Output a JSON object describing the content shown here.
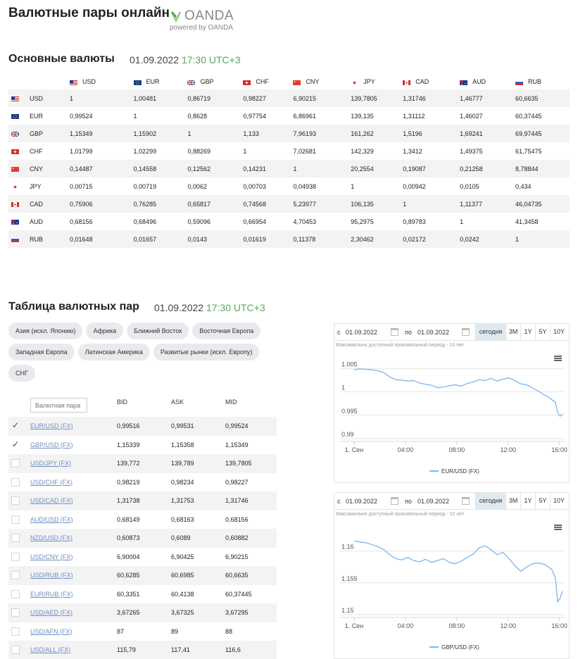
{
  "header": {
    "title": "Валютные пары онлайн",
    "brand": "OANDA",
    "brand_sub": "powered by OANDA"
  },
  "matrix_section": {
    "title": "Основные валюты",
    "date": "01.09.2022",
    "time": "17:30 UTC+3"
  },
  "currencies": [
    "USD",
    "EUR",
    "GBP",
    "CHF",
    "CNY",
    "JPY",
    "CAD",
    "AUD",
    "RUB"
  ],
  "matrix_rows": [
    [
      "1",
      "1,00481",
      "0,86719",
      "0,98227",
      "6,90215",
      "139,7805",
      "1,31746",
      "1,46777",
      "60,6635"
    ],
    [
      "0,99524",
      "1",
      "0,8628",
      "0,97754",
      "6,86961",
      "139,135",
      "1,31112",
      "1,46027",
      "60,37445"
    ],
    [
      "1,15349",
      "1,15902",
      "1",
      "1,133",
      "7,96193",
      "161,262",
      "1,5196",
      "1,69241",
      "69,97445"
    ],
    [
      "1,01799",
      "1,02299",
      "0,88269",
      "1",
      "7,02681",
      "142,329",
      "1,3412",
      "1,49375",
      "61,75475"
    ],
    [
      "0,14487",
      "0,14558",
      "0,12562",
      "0,14231",
      "1",
      "20,2554",
      "0,19087",
      "0,21258",
      "8,78844"
    ],
    [
      "0,00715",
      "0,00719",
      "0,0062",
      "0,00703",
      "0,04938",
      "1",
      "0,00942",
      "0,0105",
      "0,434"
    ],
    [
      "0,75906",
      "0,76285",
      "0,65817",
      "0,74568",
      "5,23977",
      "106,135",
      "1",
      "1,11377",
      "46,04735"
    ],
    [
      "0,68156",
      "0,68496",
      "0,59096",
      "0,66954",
      "4,70453",
      "95,2975",
      "0,89783",
      "1",
      "41,3458"
    ],
    [
      "0,01648",
      "0,01657",
      "0,0143",
      "0,01619",
      "0,11378",
      "2,30462",
      "0,02172",
      "0,0242",
      "1"
    ]
  ],
  "pairs_section": {
    "title": "Таблица валютных пар",
    "date": "01.09.2022",
    "time": "17:30 UTC+3"
  },
  "regions": [
    "Азия (искл. Японию)",
    "Африка",
    "Ближний Восток",
    "Восточная Европа",
    "Западная Европа",
    "Латинская Америка",
    "Развитые рынки (искл. Европу)",
    "СНГ"
  ],
  "pairs_table": {
    "filter_placeholder": "Валютная пара",
    "col_bid": "BID",
    "col_ask": "ASK",
    "col_mid": "MID",
    "rows": [
      {
        "pair": "EUR/USD (FX)",
        "bid": "0,99516",
        "ask": "0,99531",
        "mid": "0,99524",
        "checked": true
      },
      {
        "pair": "GBP/USD (FX)",
        "bid": "1,15339",
        "ask": "1,15358",
        "mid": "1,15349",
        "checked": true
      },
      {
        "pair": "USD/JPY (FX)",
        "bid": "139,772",
        "ask": "139,789",
        "mid": "139,7805",
        "checked": false
      },
      {
        "pair": "USD/CHF (FX)",
        "bid": "0,98219",
        "ask": "0,98234",
        "mid": "0,98227",
        "checked": false
      },
      {
        "pair": "USD/CAD (FX)",
        "bid": "1,31738",
        "ask": "1,31753",
        "mid": "1,31746",
        "checked": false
      },
      {
        "pair": "AUD/USD (FX)",
        "bid": "0,68149",
        "ask": "0,68163",
        "mid": "0,68156",
        "checked": false
      },
      {
        "pair": "NZD/USD (FX)",
        "bid": "0,60873",
        "ask": "0,6089",
        "mid": "0,60882",
        "checked": false
      },
      {
        "pair": "USD/CNY (FX)",
        "bid": "6,90004",
        "ask": "6,90425",
        "mid": "6,90215",
        "checked": false
      },
      {
        "pair": "USD/RUB (FX)",
        "bid": "60,6285",
        "ask": "60,6985",
        "mid": "60,6635",
        "checked": false
      },
      {
        "pair": "EUR/RUB (FX)",
        "bid": "60,3351",
        "ask": "60,4138",
        "mid": "60,37445",
        "checked": false
      },
      {
        "pair": "USD/AED (FX)",
        "bid": "3,67265",
        "ask": "3,67325",
        "mid": "3,67295",
        "checked": false
      },
      {
        "pair": "USD/AFN (FX)",
        "bid": "87",
        "ask": "89",
        "mid": "88",
        "checked": false
      },
      {
        "pair": "USD/ALL (FX)",
        "bid": "115,79",
        "ask": "117,41",
        "mid": "116,6",
        "checked": false
      }
    ]
  },
  "chart_controls": {
    "from_label": "с",
    "to_label": "по",
    "from_date": "01.09.2022",
    "to_date": "01.09.2022",
    "ranges": [
      "сегодня",
      "3M",
      "1Y",
      "5Y",
      "10Y"
    ],
    "active_range": "сегодня",
    "note": "Максимально доступный произвольный период - 10 лет"
  },
  "colors": {
    "accent_time": "#5aa85a",
    "chart_line": "#7cb5ec",
    "link": "#6a8ec2",
    "chip_bg": "#e8eaed"
  },
  "chart_data": [
    {
      "type": "line",
      "legend": "EUR/USD (FX)",
      "x_ticks": [
        "1. Сен",
        "04:00",
        "08:00",
        "12:00",
        "16:00"
      ],
      "y_ticks": [
        "1.005",
        "1",
        "0.995",
        "0.99"
      ],
      "ylim": [
        0.99,
        1.0055
      ],
      "x_range_hours": [
        0,
        17.5
      ],
      "series": [
        {
          "name": "EUR/USD (FX)",
          "x": [
            0,
            0.5,
            1,
            1.5,
            2,
            2.5,
            3,
            3.5,
            4,
            4.5,
            5,
            5.5,
            6,
            6.5,
            7,
            7.5,
            8,
            8.5,
            9,
            9.5,
            10,
            10.5,
            11,
            11.5,
            12,
            12.5,
            13,
            13.5,
            14,
            14.5,
            15,
            15.5,
            16,
            16.3,
            16.6,
            16.9,
            17.1,
            17.3,
            17.5
          ],
          "values": [
            1.0047,
            1.0049,
            1.0048,
            1.0047,
            1.0045,
            1.0041,
            1.0032,
            1.0026,
            1.0025,
            1.0023,
            1.0024,
            1.0019,
            1.0016,
            1.0014,
            1.0009,
            1.001,
            1.0013,
            1.0015,
            1.0012,
            1.0018,
            1.0021,
            1.0026,
            1.0024,
            1.0029,
            1.0023,
            1.0027,
            1.003,
            1.0024,
            1.0017,
            1.0015,
            1.0008,
            1.0001,
            0.9993,
            0.9989,
            0.9983,
            0.9978,
            0.9955,
            0.9948,
            0.9953
          ]
        }
      ]
    },
    {
      "type": "line",
      "legend": "GBP/USD (FX)",
      "x_ticks": [
        "1. Сен",
        "04:00",
        "08:00",
        "12:00",
        "16:00"
      ],
      "y_ticks": [
        "1.16",
        "1.155",
        "1.15"
      ],
      "ylim": [
        1.15,
        1.1625
      ],
      "x_range_hours": [
        0,
        17.5
      ],
      "series": [
        {
          "name": "GBP/USD (FX)",
          "x": [
            0,
            0.5,
            1,
            1.5,
            2,
            2.5,
            3,
            3.5,
            4,
            4.5,
            5,
            5.5,
            6,
            6.5,
            7,
            7.5,
            8,
            8.5,
            9,
            9.5,
            10,
            10.5,
            11,
            11.5,
            12,
            12.5,
            13,
            13.5,
            14,
            14.5,
            15,
            15.5,
            16,
            16.3,
            16.6,
            16.9,
            17.1,
            17.3,
            17.5
          ],
          "values": [
            1.1616,
            1.1614,
            1.1613,
            1.161,
            1.1607,
            1.1602,
            1.1594,
            1.1588,
            1.1586,
            1.159,
            1.1585,
            1.1583,
            1.1587,
            1.1582,
            1.1585,
            1.1588,
            1.1582,
            1.158,
            1.1584,
            1.159,
            1.1595,
            1.1605,
            1.1608,
            1.1602,
            1.1594,
            1.1598,
            1.1588,
            1.1577,
            1.1568,
            1.1575,
            1.158,
            1.1581,
            1.1579,
            1.1575,
            1.1571,
            1.1558,
            1.152,
            1.1526,
            1.1537
          ]
        }
      ]
    }
  ]
}
